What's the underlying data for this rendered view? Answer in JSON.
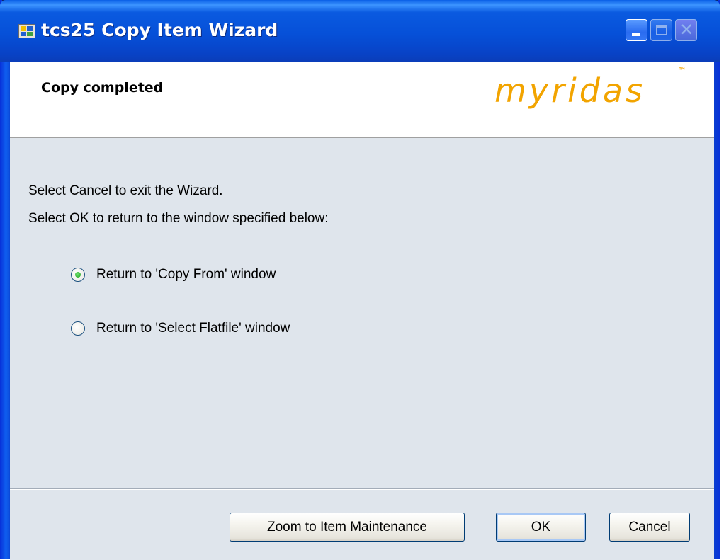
{
  "window": {
    "title": "tcs25 Copy Item Wizard",
    "buttons": [
      "minimize",
      "maximize",
      "close"
    ]
  },
  "header": {
    "title": "Copy completed",
    "logo": "myridas",
    "logo_tm": "™",
    "logo_color": "#f2a400"
  },
  "body": {
    "line1": "Select Cancel to exit the Wizard.",
    "line2": "Select OK to return to the window specified below:",
    "options": [
      {
        "label": "Return to 'Copy From' window",
        "selected": true
      },
      {
        "label": "Return to 'Select Flatfile' window",
        "selected": false
      }
    ]
  },
  "footer": {
    "zoom_label": "Zoom to Item Maintenance",
    "ok_label": "OK",
    "cancel_label": "Cancel"
  },
  "colors": {
    "titlebar": "#0650d8",
    "body_bg": "#dfe5ec",
    "accent_radio": "#21a121"
  }
}
